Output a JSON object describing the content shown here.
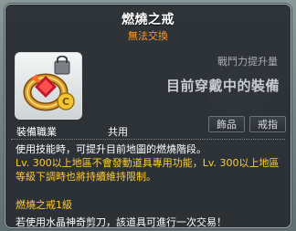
{
  "item": {
    "name": "燃燒之戒",
    "trade_status": "無法交換",
    "icon": "gold-ring-with-ruby-icon"
  },
  "comparison": {
    "power_label": "戰鬥力提升量",
    "status": "目前穿戴中的裝備"
  },
  "info": {
    "job_label": "裝備職業",
    "job_value": "共用"
  },
  "tags": [
    "飾品",
    "戒指"
  ],
  "description": {
    "line1": "使用技能時，可提升目前地圖的燃燒階段。",
    "line2": "Lv. 300以上地區不會發動道具專用功能，Lv. 300以上地區等級下調時也將持續維持限制。",
    "set_name": "燃燒之戒1級",
    "scissors_note": "若使用水晶神奇剪刀，該道具可進行一次交易！"
  },
  "colors": {
    "title": "#ffffff",
    "trade_status": "#ff9a2e",
    "highlight": "#ffcc33",
    "background": "#282c32"
  }
}
